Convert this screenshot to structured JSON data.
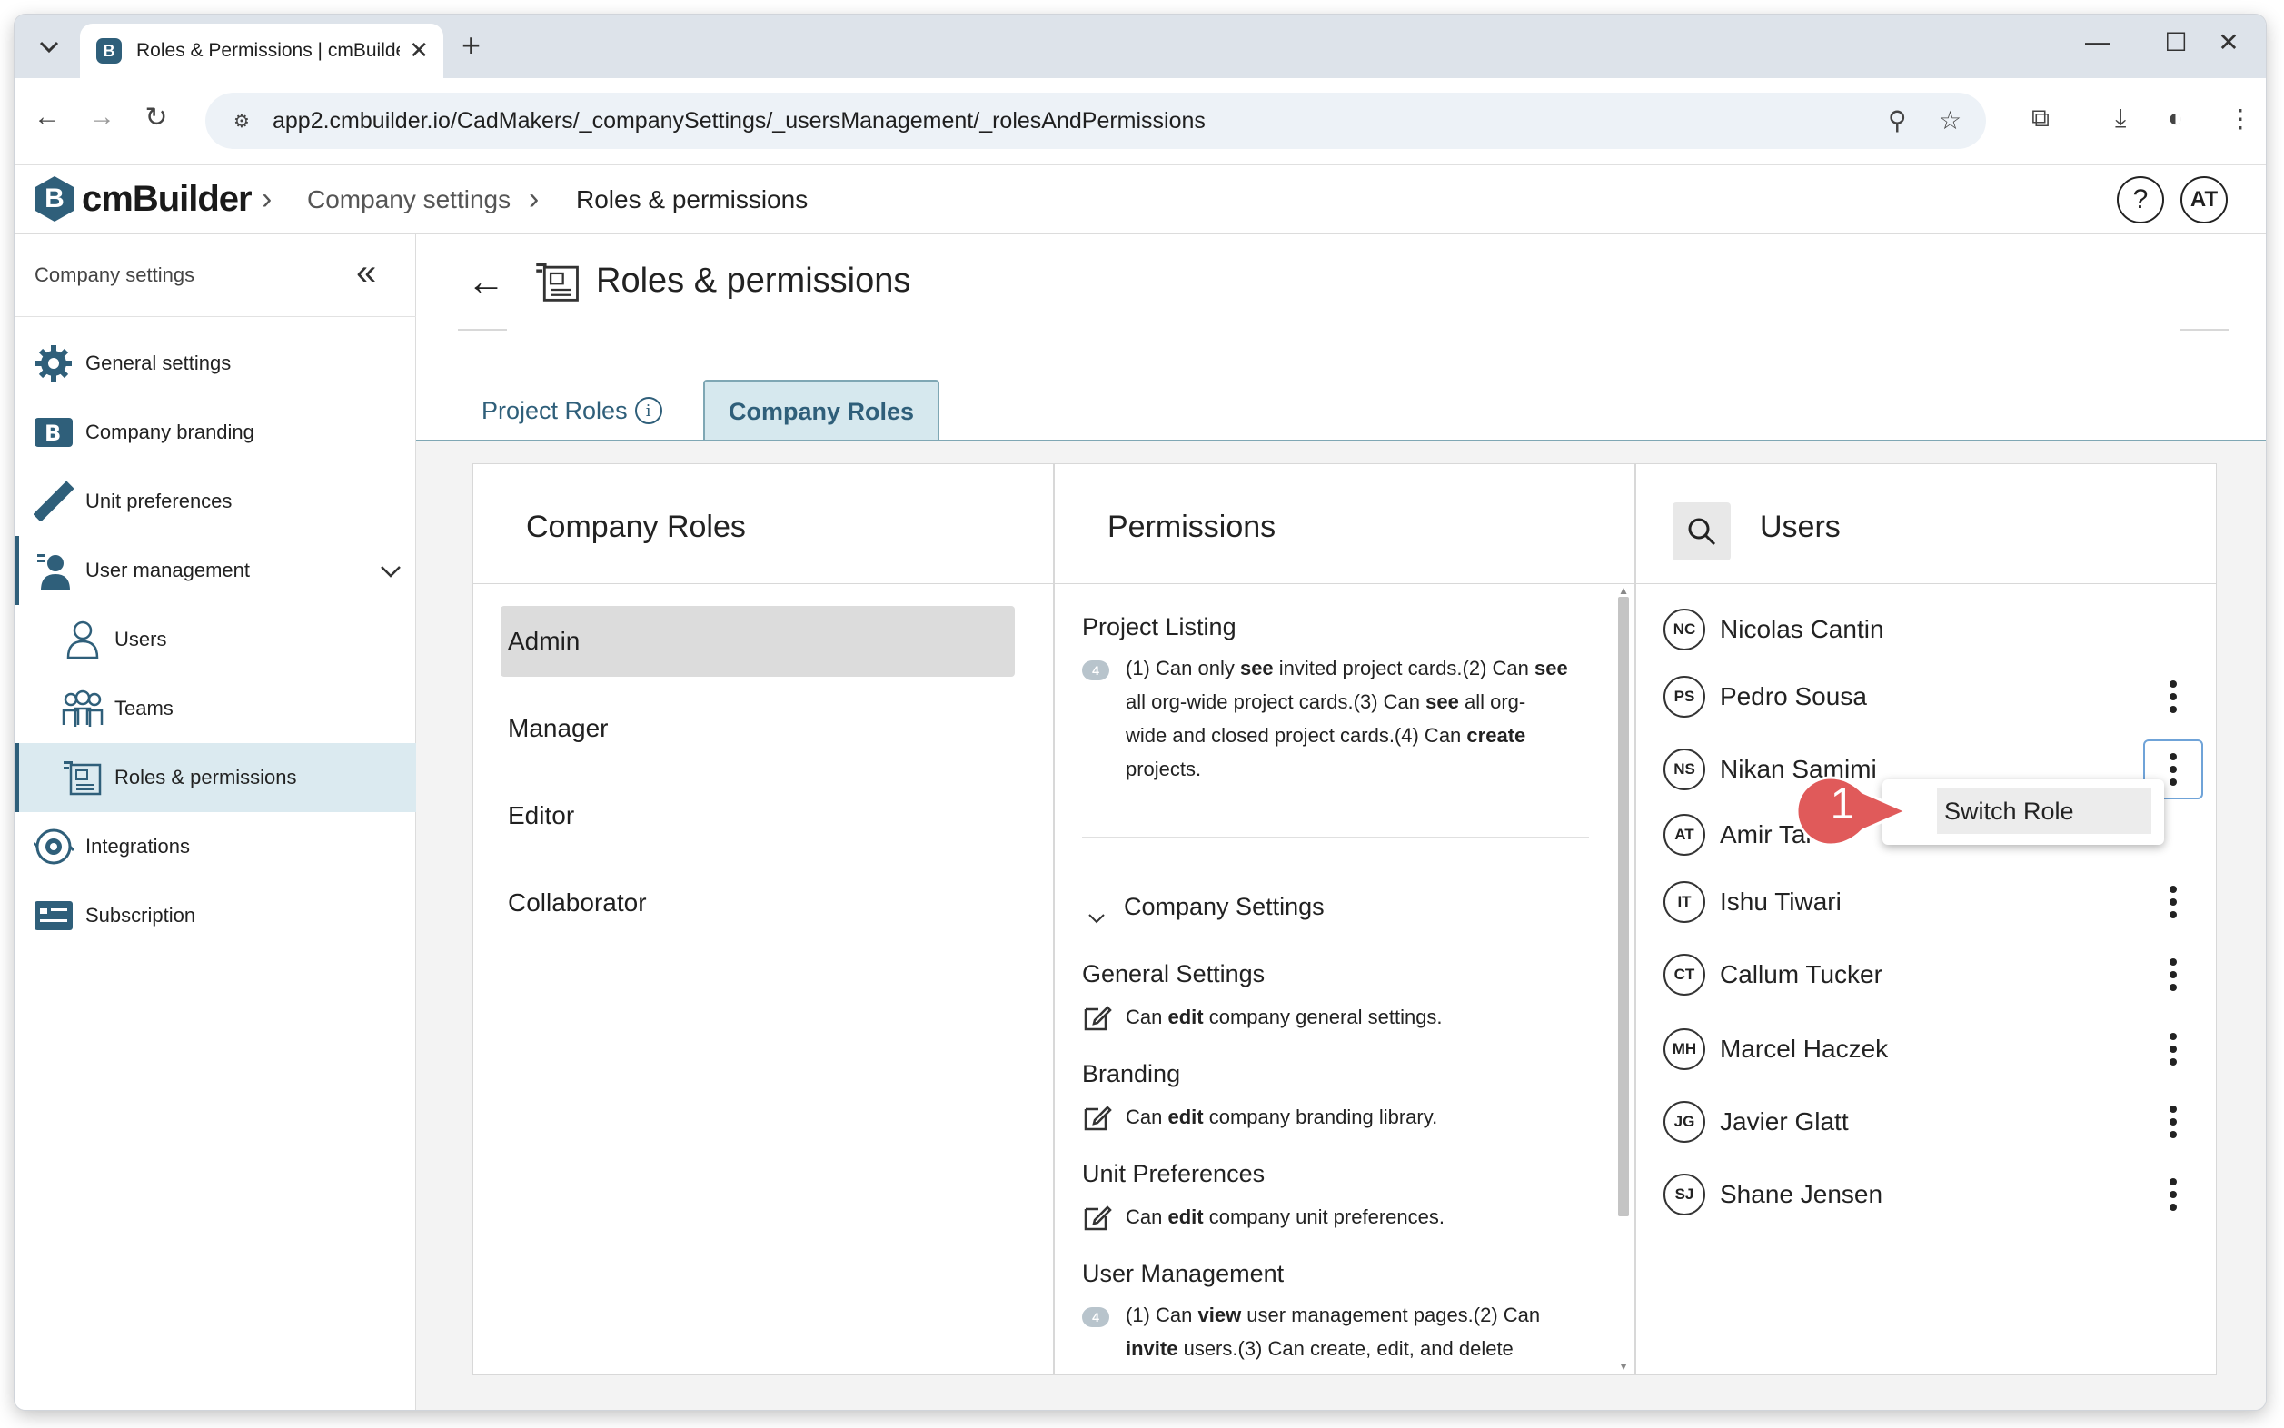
{
  "browser": {
    "tab_title": "Roles & Permissions | cmBuilder",
    "tab_favicon": "B",
    "url": "app2.cmbuilder.io/CadMakers/_companySettings/_usersManagement/_rolesAndPermissions"
  },
  "header": {
    "logo_badge": "B",
    "logo_text": "cmBuilder",
    "breadcrumb": [
      "Company settings",
      "Roles & permissions"
    ],
    "help_label": "?",
    "user_initials": "AT"
  },
  "sidebar": {
    "title": "Company settings",
    "items": [
      {
        "label": "General settings",
        "icon": "gear-icon"
      },
      {
        "label": "Company branding",
        "icon": "branding-icon"
      },
      {
        "label": "Unit preferences",
        "icon": "ruler-icon"
      },
      {
        "label": "User management",
        "icon": "user-management-icon"
      },
      {
        "label": "Users",
        "icon": "user-icon"
      },
      {
        "label": "Teams",
        "icon": "team-icon"
      },
      {
        "label": "Roles & permissions",
        "icon": "roles-icon"
      },
      {
        "label": "Integrations",
        "icon": "integrations-icon"
      },
      {
        "label": "Subscription",
        "icon": "subscription-icon"
      }
    ]
  },
  "page": {
    "title": "Roles & permissions",
    "tabs": [
      "Project Roles",
      "Company Roles"
    ]
  },
  "roles_panel": {
    "title": "Company Roles",
    "roles": [
      "Admin",
      "Manager",
      "Editor",
      "Collaborator"
    ]
  },
  "permissions_panel": {
    "title": "Permissions",
    "project_listing": {
      "heading": "Project Listing",
      "badge": "4",
      "line1a": "(1) Can only ",
      "line1b": "see",
      "line1c": " invited project cards.(2) Can ",
      "line1d": "see",
      "line2a": "all org-wide project cards.(3) Can ",
      "line2b": "see",
      "line2c": " all org-",
      "line3a": "wide and closed project cards.(4) Can ",
      "line3b": "create",
      "line4": "projects."
    },
    "company_settings_label": "Company Settings",
    "general_settings": {
      "heading": "General Settings",
      "pre": "Can ",
      "bold": "edit",
      "post": " company general settings."
    },
    "branding": {
      "heading": "Branding",
      "pre": "Can ",
      "bold": "edit",
      "post": " company branding library."
    },
    "unit_preferences": {
      "heading": "Unit Preferences",
      "pre": "Can ",
      "bold": "edit",
      "post": " company unit preferences."
    },
    "user_management": {
      "heading": "User Management",
      "badge": "4",
      "line1a": "(1) Can ",
      "line1b": "view",
      "line1c": " user management pages.(2) Can",
      "line2a": "invite",
      "line2b": " users.(3) Can create, edit, and delete"
    }
  },
  "users_panel": {
    "title": "Users",
    "users": [
      {
        "initials": "NC",
        "name": "Nicolas Cantin"
      },
      {
        "initials": "PS",
        "name": "Pedro Sousa"
      },
      {
        "initials": "NS",
        "name": "Nikan Samimi"
      },
      {
        "initials": "AT",
        "name": "Amir Tal"
      },
      {
        "initials": "IT",
        "name": "Ishu Tiwari"
      },
      {
        "initials": "CT",
        "name": "Callum Tucker"
      },
      {
        "initials": "MH",
        "name": "Marcel Haczek"
      },
      {
        "initials": "JG",
        "name": "Javier Glatt"
      },
      {
        "initials": "SJ",
        "name": "Shane Jensen"
      }
    ]
  },
  "context_menu": {
    "switch_role": "Switch Role"
  },
  "callout": {
    "number": "1",
    "color": "#e05a5a"
  },
  "colors": {
    "accent": "#2f5f7a",
    "active_bg": "#dbeaf0"
  }
}
